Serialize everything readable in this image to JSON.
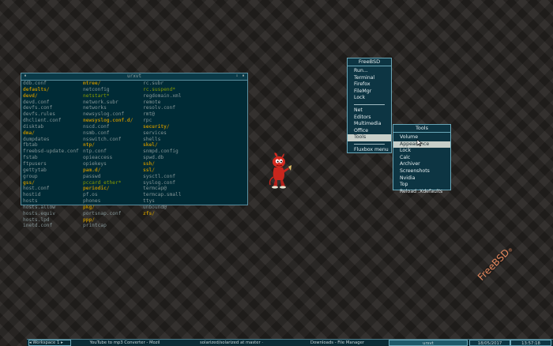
{
  "terminal": {
    "title": "urxvt",
    "columns": [
      [
        {
          "t": "ddb.conf",
          "k": "f"
        },
        {
          "t": "defaults/",
          "k": "d"
        },
        {
          "t": "devd/",
          "k": "d"
        },
        {
          "t": "devd.conf",
          "k": "f"
        },
        {
          "t": "devfs.conf",
          "k": "f"
        },
        {
          "t": "devfs.rules",
          "k": "f"
        },
        {
          "t": "dhclient.conf",
          "k": "f"
        },
        {
          "t": "disktab",
          "k": "f"
        },
        {
          "t": "dma/",
          "k": "d"
        },
        {
          "t": "dumpdates",
          "k": "f"
        },
        {
          "t": "fbtab",
          "k": "f"
        },
        {
          "t": "freebsd-update.conf",
          "k": "f"
        },
        {
          "t": "fstab",
          "k": "f"
        },
        {
          "t": "ftpusers",
          "k": "f"
        },
        {
          "t": "gettytab",
          "k": "f"
        },
        {
          "t": "group",
          "k": "f"
        },
        {
          "t": "gss/",
          "k": "d"
        },
        {
          "t": "host.conf",
          "k": "f"
        },
        {
          "t": "hostid",
          "k": "f"
        },
        {
          "t": "hosts",
          "k": "f"
        },
        {
          "t": "hosts.allow",
          "k": "f"
        },
        {
          "t": "hosts.equiv",
          "k": "f"
        },
        {
          "t": "hosts.lpd",
          "k": "f"
        },
        {
          "t": "inetd.conf",
          "k": "f"
        }
      ],
      [
        {
          "t": "mtree/",
          "k": "d"
        },
        {
          "t": "netconfig",
          "k": "f"
        },
        {
          "t": "netstart*",
          "k": "x"
        },
        {
          "t": "network.subr",
          "k": "f"
        },
        {
          "t": "networks",
          "k": "f"
        },
        {
          "t": "newsyslog.conf",
          "k": "f"
        },
        {
          "t": "newsyslog.conf.d/",
          "k": "d"
        },
        {
          "t": "nscd.conf",
          "k": "f"
        },
        {
          "t": "nsmb.conf",
          "k": "f"
        },
        {
          "t": "nsswitch.conf",
          "k": "f"
        },
        {
          "t": "ntp/",
          "k": "d"
        },
        {
          "t": "ntp.conf",
          "k": "f"
        },
        {
          "t": "opieaccess",
          "k": "f"
        },
        {
          "t": "opiekeys",
          "k": "f"
        },
        {
          "t": "pam.d/",
          "k": "d"
        },
        {
          "t": "passwd",
          "k": "f"
        },
        {
          "t": "pccard_ether*",
          "k": "x"
        },
        {
          "t": "periodic/",
          "k": "d"
        },
        {
          "t": "pf.os",
          "k": "f"
        },
        {
          "t": "phones",
          "k": "f"
        },
        {
          "t": "pkg/",
          "k": "d"
        },
        {
          "t": "portsnap.conf",
          "k": "f"
        },
        {
          "t": "ppp/",
          "k": "d"
        },
        {
          "t": "printcap",
          "k": "f"
        }
      ],
      [
        {
          "t": "rc.subr",
          "k": "f"
        },
        {
          "t": "rc.suspend*",
          "k": "x"
        },
        {
          "t": "regdomain.xml",
          "k": "f"
        },
        {
          "t": "remote",
          "k": "f"
        },
        {
          "t": "resolv.conf",
          "k": "f"
        },
        {
          "t": "rmt@",
          "k": "f"
        },
        {
          "t": "rpc",
          "k": "f"
        },
        {
          "t": "security/",
          "k": "d"
        },
        {
          "t": "services",
          "k": "f"
        },
        {
          "t": "shells",
          "k": "f"
        },
        {
          "t": "skel/",
          "k": "d"
        },
        {
          "t": "snmpd.config",
          "k": "f"
        },
        {
          "t": "spwd.db",
          "k": "f"
        },
        {
          "t": "ssh/",
          "k": "d"
        },
        {
          "t": "ssl/",
          "k": "d"
        },
        {
          "t": "sysctl.conf",
          "k": "f"
        },
        {
          "t": "syslog.conf",
          "k": "f"
        },
        {
          "t": "termcap@",
          "k": "f"
        },
        {
          "t": "termcap.small",
          "k": "f"
        },
        {
          "t": "ttys",
          "k": "f"
        },
        {
          "t": "unbound@",
          "k": "f"
        },
        {
          "t": "zfs/",
          "k": "d"
        }
      ]
    ]
  },
  "root_menu": {
    "title": "FreeBSD",
    "items": [
      {
        "label": "Run..."
      },
      {
        "label": "Terminal"
      },
      {
        "label": "Firefox"
      },
      {
        "label": "FileMgr"
      },
      {
        "label": "Lock"
      },
      {
        "sep": true
      },
      {
        "label": "Net"
      },
      {
        "label": "Editors"
      },
      {
        "label": "Multimedia"
      },
      {
        "label": "Office"
      },
      {
        "label": "Tools",
        "selected": true
      },
      {
        "sep": true
      },
      {
        "label": "Fluxbox menu"
      }
    ]
  },
  "tools_menu": {
    "title": "Tools",
    "items": [
      {
        "label": "Volume"
      },
      {
        "label": "Appearance",
        "selected": true
      },
      {
        "label": "Lock"
      },
      {
        "label": "Calc"
      },
      {
        "label": "Archiver"
      },
      {
        "label": "Screenshots"
      },
      {
        "label": "Nvidia"
      },
      {
        "label": "Top"
      },
      {
        "label": "Reload .Xdefaults"
      }
    ]
  },
  "taskbar": {
    "workspace": "Workspace 1",
    "tasks": [
      {
        "label": "YouTube to mp3 Converter - Mozil"
      },
      {
        "label": "solarized/solarized at master ·"
      },
      {
        "label": "Downloads - File Manager"
      },
      {
        "label": "urxvt",
        "active": true
      }
    ],
    "date": "18/05/2017",
    "time": "13:57:18"
  },
  "desktop": {
    "logo_text": "FreeBSD"
  },
  "colors": {
    "term_bg": "#002b36",
    "dir": "#b58900",
    "exe": "#859900",
    "file": "#839496",
    "menu_bg": "#0d3543"
  }
}
